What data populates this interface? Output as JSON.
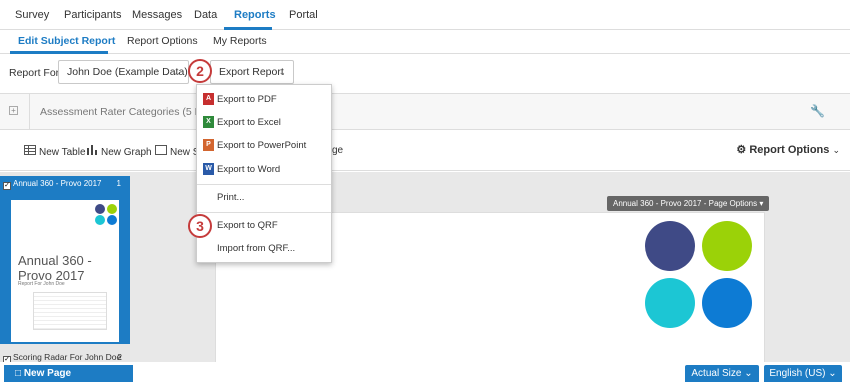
{
  "top_tabs": [
    "Survey",
    "Participants",
    "Messages",
    "Data",
    "Reports",
    "Portal"
  ],
  "sub_tabs": [
    "Edit Subject Report",
    "Report Options",
    "My Reports"
  ],
  "report_for": {
    "label": "Report For",
    "value": "John Doe (Example Data)"
  },
  "export_button": "Export Report",
  "categories_title": "Assessment Rater Categories (5 Data S",
  "toolbar": {
    "new_table": "New Table",
    "new_graph": "New Graph",
    "new_shape_partial": "New Sh",
    "page_partial": "ge",
    "report_options": "Report Options"
  },
  "export_menu": {
    "items": [
      {
        "label": "Export to PDF",
        "icon": "pdf-icon"
      },
      {
        "label": "Export to Excel",
        "icon": "excel-icon"
      },
      {
        "label": "Export to PowerPoint",
        "icon": "powerpoint-icon"
      },
      {
        "label": "Export to Word",
        "icon": "word-icon"
      },
      {
        "label": "Print..."
      },
      {
        "label": "Export to QRF"
      },
      {
        "label": "Import from QRF..."
      }
    ]
  },
  "callouts": [
    "2",
    "3"
  ],
  "sidebar": {
    "page1": {
      "label": "Annual 360 - Provo 2017",
      "num": "1",
      "thumb_title": "Annual 360 - Provo 2017",
      "thumb_subtitle": "Report For John Doe"
    },
    "page2": {
      "label": "Scoring Radar For John Doe",
      "num": "2"
    }
  },
  "page_options": "Annual 360 - Provo 2017 - Page Options",
  "footer": {
    "new_page": "New Page",
    "actual_size": "Actual Size",
    "language": "English (US)"
  },
  "colors": {
    "accent": "#1d7cc4",
    "navy_circle": "#3f4a86",
    "green_circle": "#9bd208",
    "cyan_circle": "#1cc6d4",
    "blue_circle": "#0d7bd4",
    "callout": "#c53b3b"
  }
}
